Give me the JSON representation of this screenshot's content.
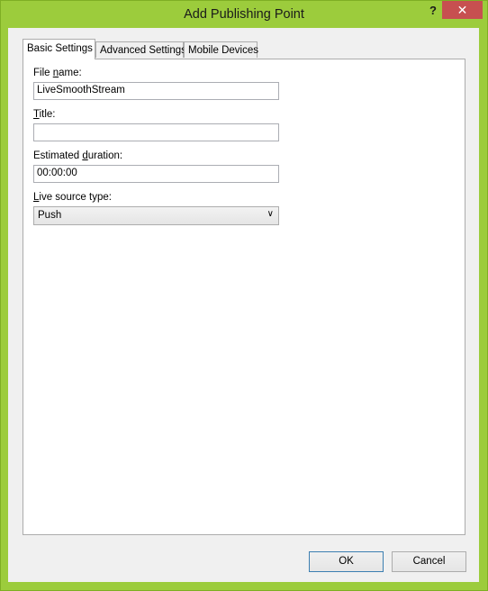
{
  "window": {
    "title": "Add Publishing Point",
    "help_label": "?",
    "close_label": "✕",
    "frame_color": "#9ccc3c",
    "close_color": "#c75050"
  },
  "tabs": [
    {
      "label": "Basic Settings",
      "active": true
    },
    {
      "label": "Advanced Settings",
      "active": false
    },
    {
      "label": "Mobile Devices",
      "active": false
    }
  ],
  "form": {
    "file_name": {
      "label_pre": "File ",
      "label_accel": "n",
      "label_post": "ame:",
      "value": ""
    },
    "title": {
      "label_pre": "",
      "label_accel": "T",
      "label_post": "itle:",
      "value": ""
    },
    "duration": {
      "label_pre": "Estimated ",
      "label_accel": "d",
      "label_post": "uration:",
      "value": "00:00:00"
    },
    "source_type": {
      "label_pre": "",
      "label_accel": "L",
      "label_post": "ive source type:",
      "value": "Push"
    }
  },
  "file_name_value": "LiveSmoothStream",
  "buttons": {
    "ok": "OK",
    "cancel": "Cancel"
  }
}
